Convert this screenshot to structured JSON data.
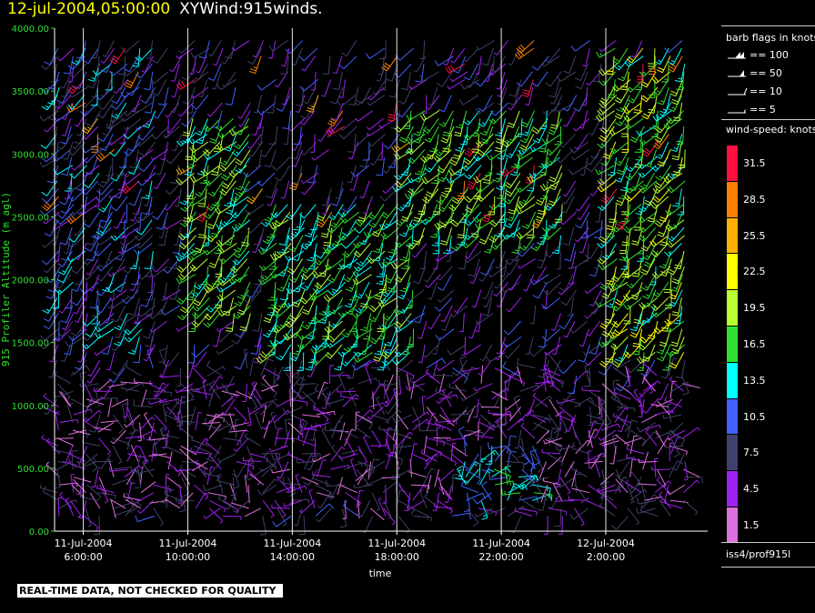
{
  "header": {
    "datetime": "12-jul-2004,05:00:00",
    "title": "XYWind:915winds."
  },
  "chart_data": {
    "type": "scatter",
    "subtype": "wind-barb profile time-height plot",
    "title": "XYWind:915winds.",
    "xlabel": "time",
    "ylabel": "915 Profiler Altitude (m agl)",
    "ylim": [
      0,
      4000
    ],
    "y_ticks": [
      "0.00",
      "500.00",
      "1000.00",
      "1500.00",
      "2000.00",
      "2500.00",
      "3000.00",
      "3500.00",
      "4000.00"
    ],
    "x_ticks": [
      {
        "date": "11-Jul-2004",
        "time": "6:00:00"
      },
      {
        "date": "11-Jul-2004",
        "time": "10:00:00"
      },
      {
        "date": "11-Jul-2004",
        "time": "14:00:00"
      },
      {
        "date": "11-Jul-2004",
        "time": "18:00:00"
      },
      {
        "date": "11-Jul-2004",
        "time": "22:00:00"
      },
      {
        "date": "12-Jul-2004",
        "time": "2:00:00"
      }
    ],
    "x_range_hours": [
      4.9,
      29.9
    ],
    "grid": "vertical lines at x ticks",
    "colorbar": {
      "title": "wind-speed: knots",
      "levels": [
        "31.5",
        "28.5",
        "25.5",
        "22.5",
        "19.5",
        "16.5",
        "13.5",
        "10.5",
        "7.5",
        "4.5",
        "1.5"
      ],
      "colors": [
        "#ff1040",
        "#ff8000",
        "#ffb000",
        "#ffff00",
        "#b8ff30",
        "#30e030",
        "#00ffff",
        "#4060ff",
        "#40406a",
        "#a020f0",
        "#e070e0"
      ]
    },
    "barb_key": {
      "title": "barb flags in knots",
      "entries": [
        "== 100",
        "== 50",
        "== 10",
        "== 5"
      ]
    },
    "regimes": [
      {
        "t0": 5.0,
        "t1": 9.0,
        "h0": 1500,
        "h1": 3900,
        "spd": 9
      },
      {
        "t0": 10.0,
        "t1": 12.5,
        "h0": 1700,
        "h1": 3300,
        "spd": 17
      },
      {
        "t0": 13.0,
        "t1": 19.0,
        "h0": 1400,
        "h1": 2600,
        "spd": 16
      },
      {
        "t0": 18.5,
        "t1": 24.5,
        "h0": 2300,
        "h1": 3400,
        "spd": 17
      },
      {
        "t0": 26.0,
        "t1": 29.5,
        "h0": 1400,
        "h1": 3900,
        "spd": 18
      },
      {
        "t0": 20.5,
        "t1": 23.5,
        "h0": 200,
        "h1": 700,
        "spd": 12
      },
      {
        "t0": 5.0,
        "t1": 29.5,
        "h0": 150,
        "h1": 1200,
        "spd": 5
      }
    ]
  },
  "legend": {
    "station": "iss4/prof915l"
  },
  "disclaimer": "REAL-TIME DATA, NOT CHECKED FOR QUALITY"
}
